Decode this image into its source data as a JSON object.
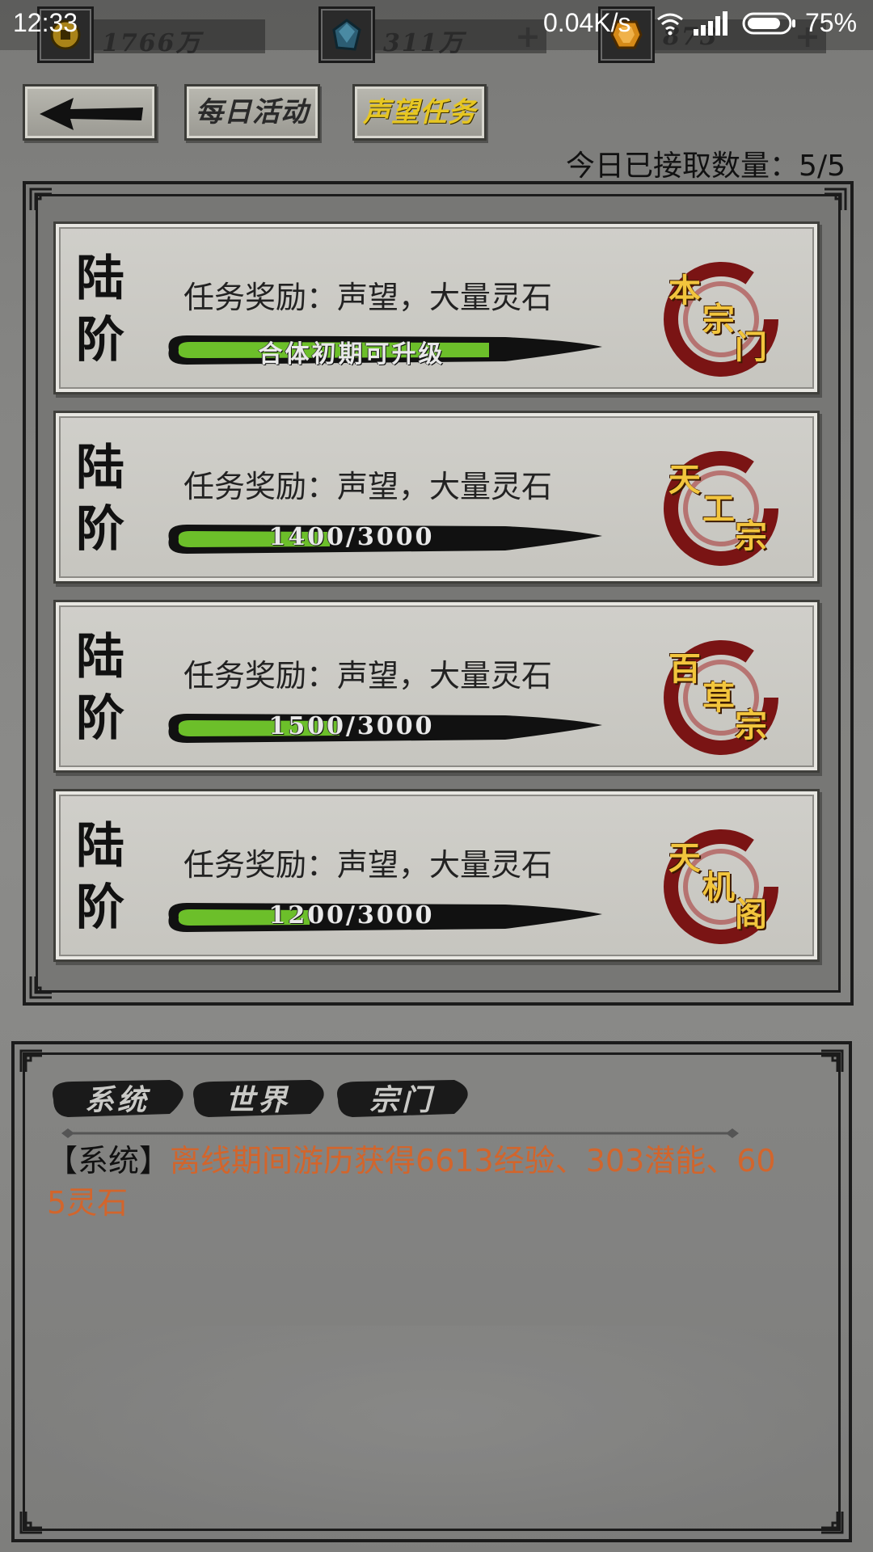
{
  "status_bar": {
    "time": "12:33",
    "net_speed": "0.04K/s",
    "battery": "75%"
  },
  "resources": [
    {
      "icon": "gold-coin-icon",
      "value": "1766万",
      "color": "#c9a227"
    },
    {
      "icon": "blue-crystal-icon",
      "value": "311万",
      "color": "#2c5d73"
    },
    {
      "icon": "orange-gem-icon",
      "value": "873",
      "color": "#d68a18"
    }
  ],
  "nav": {
    "daily_label": "每日活动",
    "prestige_label": "声望任务"
  },
  "accepted_count": "今日已接取数量：5/5",
  "tasks": [
    {
      "tier_1": "陆",
      "tier_2": "阶",
      "reward": "任务奖励：声望，大量灵石",
      "progress_text": "合体初期可升级",
      "progress": 1.0,
      "sect_1": "本",
      "sect_2": "宗",
      "sect_3": "门"
    },
    {
      "tier_1": "陆",
      "tier_2": "阶",
      "reward": "任务奖励：声望，大量灵石",
      "progress_text": "1400/3000",
      "progress": 0.467,
      "sect_1": "天",
      "sect_2": "工",
      "sect_3": "宗"
    },
    {
      "tier_1": "陆",
      "tier_2": "阶",
      "reward": "任务奖励：声望，大量灵石",
      "progress_text": "1500/3000",
      "progress": 0.5,
      "sect_1": "百",
      "sect_2": "草",
      "sect_3": "宗"
    },
    {
      "tier_1": "陆",
      "tier_2": "阶",
      "reward": "任务奖励：声望，大量灵石",
      "progress_text": "1200/3000",
      "progress": 0.4,
      "sect_1": "天",
      "sect_2": "机",
      "sect_3": "阁"
    }
  ],
  "chat": {
    "tabs": [
      "系统",
      "世界",
      "宗门"
    ],
    "message_tag": "【系统】",
    "message_text": "离线期间游历获得6613经验、303潜能、605灵石"
  }
}
